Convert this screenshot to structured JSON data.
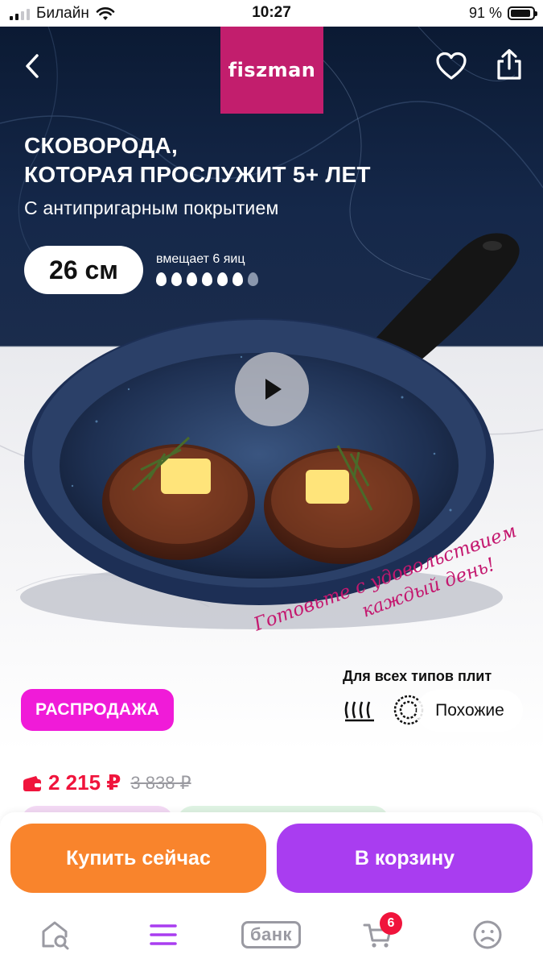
{
  "status_bar": {
    "carrier": "Билайн",
    "time": "10:27",
    "battery": "91 %"
  },
  "hero": {
    "brand": "fiszman",
    "headline_lines": [
      "СКОВОРОДА,",
      "КОТОРАЯ ПРОСЛУЖИТ 5+ ЛЕТ"
    ],
    "subline": "С антипригарным покрытием",
    "size": "26 см",
    "capacity": "вмещает 6 яиц",
    "slogan_lines": [
      "Готовьте с удовольствием",
      "каждый день!"
    ],
    "stoves_title": "Для всех типов плит",
    "sale_badge": "РАСПРОДАЖА",
    "similar_chip": "Похожие"
  },
  "price": {
    "current": "2 215 ₽",
    "old": "3 838 ₽"
  },
  "actions": {
    "buy_now": "Купить сейчас",
    "add_to_cart": "В корзину"
  },
  "tab_bar": {
    "bank": "банк",
    "cart_badge": "6"
  },
  "colors": {
    "brand": "#c21e6d",
    "sale": "#f01bd8",
    "price": "#f0143c",
    "buy_button": "#f9842c",
    "cart_button": "#a93df0"
  },
  "icons": [
    "back-icon",
    "heart-icon",
    "share-icon",
    "play-icon",
    "wallet-icon",
    "home-search-icon",
    "menu-icon",
    "cart-icon",
    "profile-icon"
  ]
}
